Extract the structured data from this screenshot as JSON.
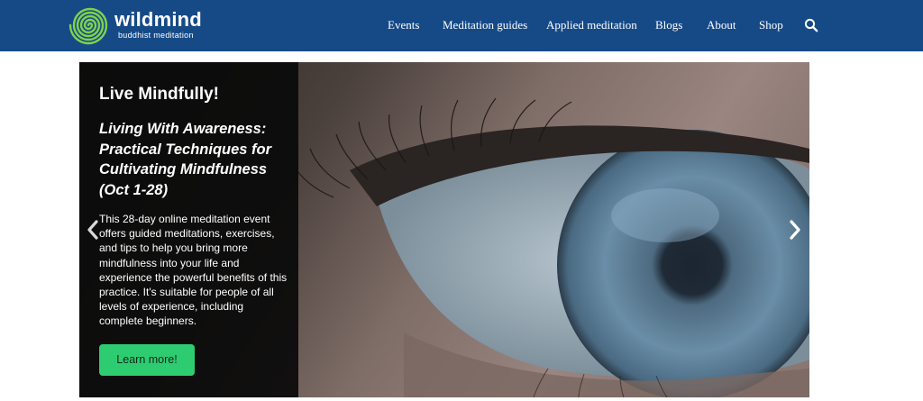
{
  "brand": {
    "name": "wildmind",
    "tagline": "buddhist meditation",
    "logo_icon": "spiral-logo-icon",
    "colors": {
      "header_bg": "#164a87",
      "logo_green": "#7fd34a",
      "button_green": "#2ecc71"
    }
  },
  "nav": {
    "items": [
      {
        "label": "Events"
      },
      {
        "label": "Meditation guides"
      },
      {
        "label": "Applied meditation"
      },
      {
        "label": "Blogs"
      },
      {
        "label": "About"
      },
      {
        "label": "Shop"
      }
    ],
    "search_icon": "search-icon"
  },
  "hero": {
    "headline": "Live Mindfully!",
    "subhead": "Living With Awareness: Practical Techniques for Cultivating Mindfulness (Oct 1-28)",
    "body": "This 28-day online meditation event offers guided meditations, exercises, and tips to help you bring more mindfulness into your life and experience the powerful benefits of this practice. It's suitable for people of all levels of experience, including complete beginners.",
    "cta_label": "Learn more!",
    "image_icon": "eye-closeup-photo",
    "prev_icon": "chevron-left-icon",
    "next_icon": "chevron-right-icon"
  }
}
